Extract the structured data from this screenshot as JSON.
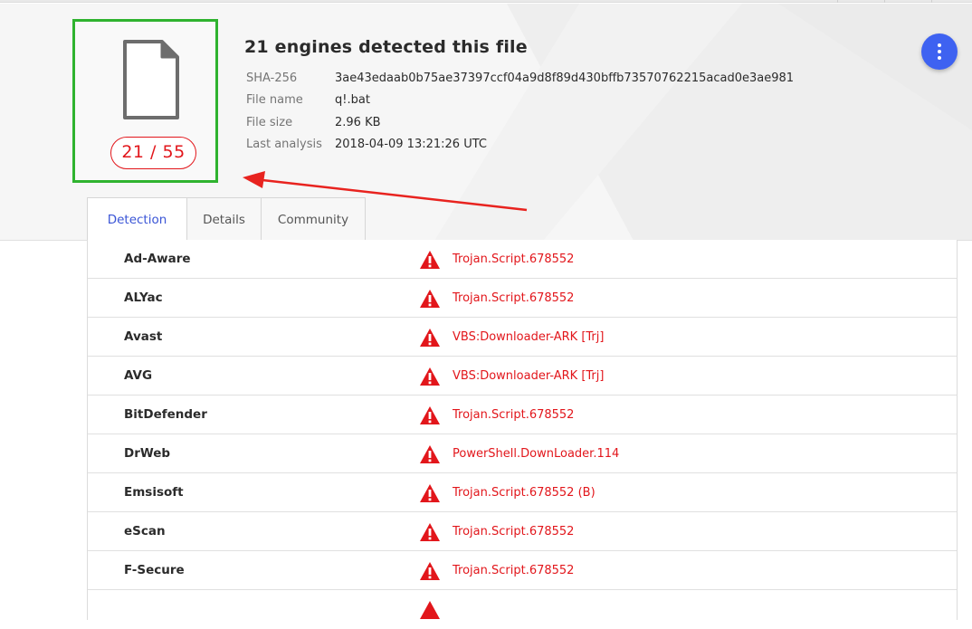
{
  "summary": {
    "title": "21 engines detected this file",
    "score": "21 / 55",
    "meta": [
      {
        "key": "SHA-256",
        "value": "3ae43edaab0b75ae37397ccf04a9d8f89d430bffb73570762215acad0e3ae981"
      },
      {
        "key": "File name",
        "value": "q!.bat"
      },
      {
        "key": "File size",
        "value": "2.96 KB"
      },
      {
        "key": "Last analysis",
        "value": "2018-04-09 13:21:26 UTC"
      }
    ]
  },
  "tabs": [
    {
      "label": "Detection",
      "active": true
    },
    {
      "label": "Details",
      "active": false
    },
    {
      "label": "Community",
      "active": false
    }
  ],
  "detections": [
    {
      "engine": "Ad-Aware",
      "result": "Trojan.Script.678552"
    },
    {
      "engine": "ALYac",
      "result": "Trojan.Script.678552"
    },
    {
      "engine": "Avast",
      "result": "VBS:Downloader-ARK [Trj]"
    },
    {
      "engine": "AVG",
      "result": "VBS:Downloader-ARK [Trj]"
    },
    {
      "engine": "BitDefender",
      "result": "Trojan.Script.678552"
    },
    {
      "engine": "DrWeb",
      "result": "PowerShell.DownLoader.114"
    },
    {
      "engine": "Emsisoft",
      "result": "Trojan.Script.678552 (B)"
    },
    {
      "engine": "eScan",
      "result": "Trojan.Script.678552"
    },
    {
      "engine": "F-Secure",
      "result": "Trojan.Script.678552"
    }
  ],
  "colors": {
    "accent": "#3e62f1",
    "malicious": "#e2161b",
    "highlight_box": "#2fb32f"
  },
  "icons": {
    "file": "file-icon",
    "menu": "more-vert-icon",
    "warning": "warning-triangle-icon",
    "annotation": "red-arrow"
  }
}
